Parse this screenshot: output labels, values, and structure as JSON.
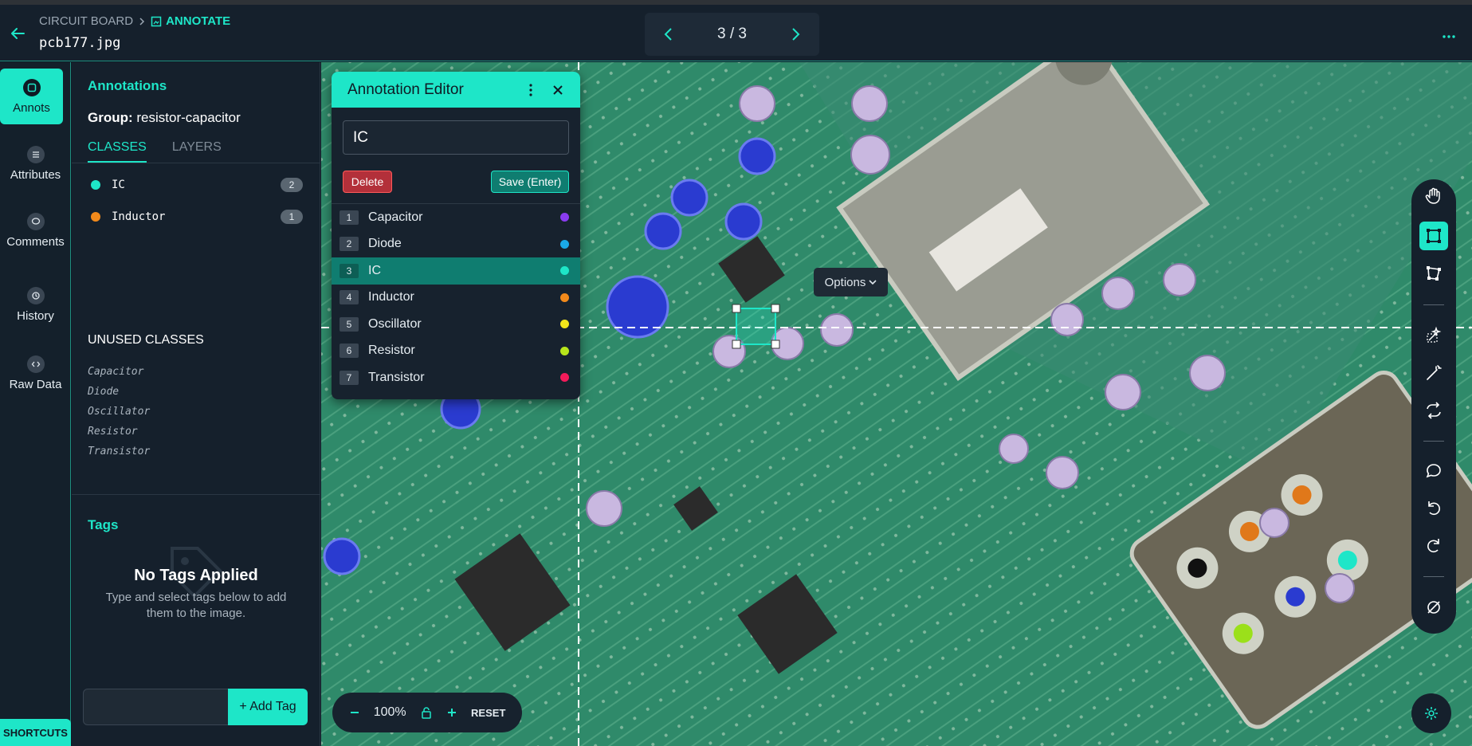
{
  "header": {
    "breadcrumb_root": "CIRCUIT BOARD",
    "breadcrumb_active": "ANNOTATE",
    "filename": "pcb177.jpg",
    "pager": "3 / 3"
  },
  "rail": {
    "items": [
      {
        "label": "Annots",
        "icon": "annotation-icon"
      },
      {
        "label": "Attributes",
        "icon": "list-icon"
      },
      {
        "label": "Comments",
        "icon": "comment-icon"
      },
      {
        "label": "History",
        "icon": "history-icon"
      },
      {
        "label": "Raw Data",
        "icon": "code-icon"
      }
    ],
    "shortcuts": "SHORTCUTS"
  },
  "panel": {
    "title": "Annotations",
    "group_label": "Group:",
    "group_value": "resistor-capacitor",
    "tabs": [
      "CLASSES",
      "LAYERS"
    ],
    "classes": [
      {
        "name": "IC",
        "count": "2",
        "color": "#1ee6c8"
      },
      {
        "name": "Inductor",
        "count": "1",
        "color": "#f28a1b"
      }
    ],
    "unused_title": "UNUSED CLASSES",
    "unused": [
      "Capacitor",
      "Diode",
      "Oscillator",
      "Resistor",
      "Transistor"
    ],
    "tags_title": "Tags",
    "no_tags_title": "No Tags Applied",
    "no_tags_sub": "Type and select tags below to add them to the image.",
    "add_tag": "+ Add Tag"
  },
  "editor": {
    "title": "Annotation Editor",
    "input_value": "IC",
    "delete": "Delete",
    "save": "Save (Enter)",
    "options": [
      {
        "num": "1",
        "label": "Capacitor",
        "color": "#8a3cf0"
      },
      {
        "num": "2",
        "label": "Diode",
        "color": "#1aa9e8"
      },
      {
        "num": "3",
        "label": "IC",
        "color": "#1ee6c8"
      },
      {
        "num": "4",
        "label": "Inductor",
        "color": "#f28a1b"
      },
      {
        "num": "5",
        "label": "Oscillator",
        "color": "#f2e61b"
      },
      {
        "num": "6",
        "label": "Resistor",
        "color": "#b8e61b"
      },
      {
        "num": "7",
        "label": "Transistor",
        "color": "#f21b5a"
      }
    ]
  },
  "canvas": {
    "options_label": "Options",
    "zoom": "100%",
    "reset": "RESET"
  }
}
